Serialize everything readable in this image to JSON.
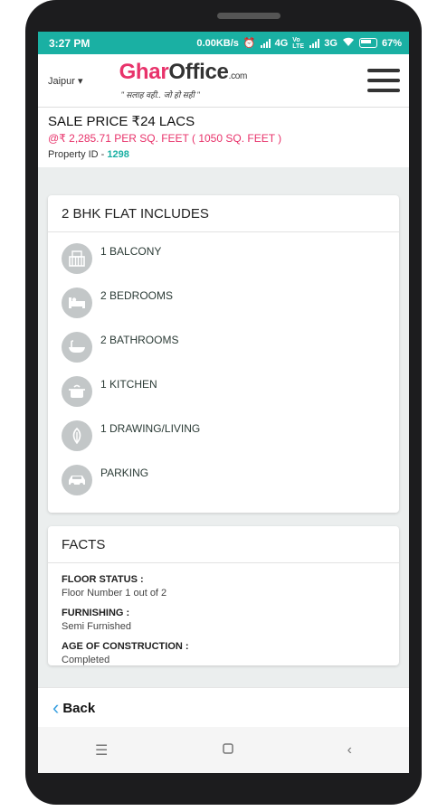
{
  "status": {
    "time": "3:27 PM",
    "speed": "0.00KB/s",
    "net1": "4G",
    "volte": "Vo LTE",
    "net2": "3G",
    "battery": "67%"
  },
  "header": {
    "city": "Jaipur",
    "logo_ghar": "Ghar",
    "logo_office": "Office",
    "logo_com": ".com",
    "tagline": "\" सलाह वही.. जो हो सही \""
  },
  "price": {
    "title": "SALE PRICE ₹24 LACS",
    "per_sqft": "@₹ 2,285.71 PER SQ. FEET ( 1050 SQ. FEET )",
    "property_id_label": "Property ID - ",
    "property_id": "1298"
  },
  "includes": {
    "title": "2 BHK FLAT INCLUDES",
    "items": [
      {
        "label": "1 BALCONY",
        "icon": "balcony-icon"
      },
      {
        "label": "2 BEDROOMS",
        "icon": "bed-icon"
      },
      {
        "label": "2 BATHROOMS",
        "icon": "bathtub-icon"
      },
      {
        "label": "1 KITCHEN",
        "icon": "kitchen-icon"
      },
      {
        "label": "1 DRAWING/LIVING",
        "icon": "living-icon"
      },
      {
        "label": "PARKING",
        "icon": "car-icon"
      }
    ]
  },
  "facts": {
    "title": "FACTS",
    "items": [
      {
        "key": "FLOOR STATUS :",
        "value": "Floor Number 1 out of 2"
      },
      {
        "key": "FURNISHING :",
        "value": "Semi Furnished"
      },
      {
        "key": "AGE OF CONSTRUCTION :",
        "value": "Completed"
      }
    ]
  },
  "footer": {
    "back_label": "Back"
  },
  "colors": {
    "accent": "#1ab0a3",
    "brand": "#e8336b",
    "link": "#3aa0e0"
  }
}
